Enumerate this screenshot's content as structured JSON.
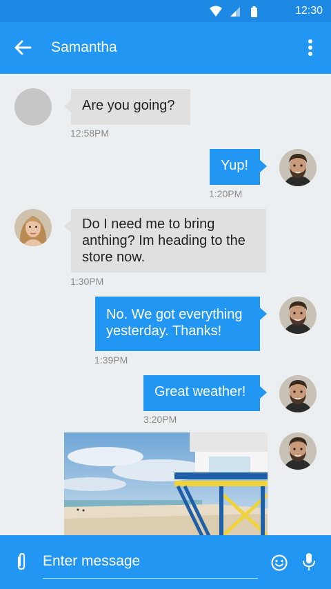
{
  "status_bar": {
    "time": "12:30",
    "icons": [
      "wifi-icon",
      "signal-icon",
      "battery-icon"
    ]
  },
  "app_bar": {
    "title": "Samantha",
    "back_icon": "arrow-back-icon",
    "menu_icon": "more-vert-icon"
  },
  "colors": {
    "primary": "#2196f3",
    "status_bar": "#1e88e5",
    "background": "#eceff1",
    "incoming_bubble": "#e0e0e0"
  },
  "messages": [
    {
      "direction": "incoming",
      "text": "Are you going?",
      "time": "12:58PM",
      "avatar": "placeholder"
    },
    {
      "direction": "outgoing",
      "text": "Yup!",
      "time": "1:20PM",
      "avatar": "bearded-man"
    },
    {
      "direction": "incoming",
      "text": "Do I need me to bring anthing? Im heading to the store now.",
      "time": "1:30PM",
      "avatar": "blonde-woman"
    },
    {
      "direction": "outgoing",
      "text": "No. We got everything yesterday. Thanks!",
      "time": "1:39PM",
      "avatar": "bearded-man"
    },
    {
      "direction": "outgoing",
      "text": "Great weather!",
      "time": "3:20PM",
      "avatar": "bearded-man"
    },
    {
      "direction": "outgoing",
      "type": "image",
      "image": "beach-lifeguard-tower-photo",
      "avatar": "bearded-man"
    }
  ],
  "composer": {
    "placeholder": "Enter message",
    "attach_icon": "paperclip-icon",
    "emoji_icon": "smiley-icon",
    "mic_icon": "mic-icon"
  }
}
